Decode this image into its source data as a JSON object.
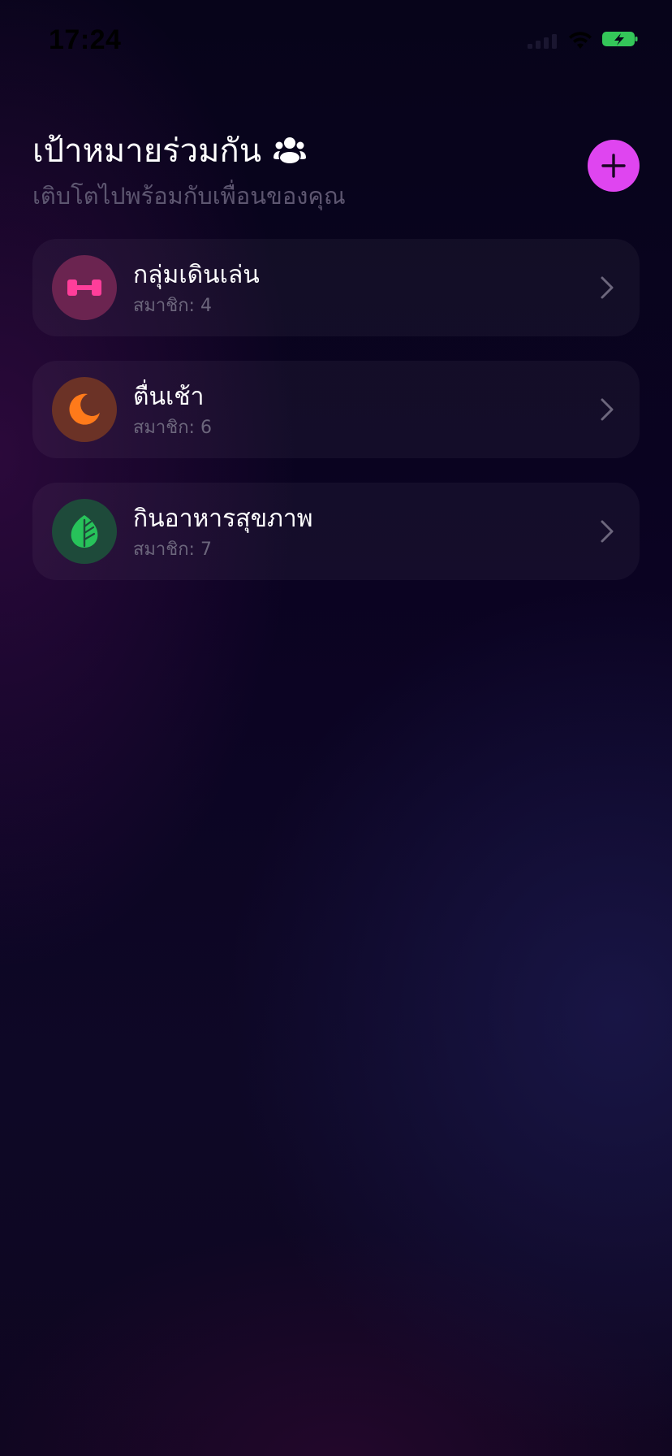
{
  "status_bar": {
    "time": "17:24",
    "battery_color": "#34c759"
  },
  "header": {
    "title": "เป้าหมายร่วมกัน",
    "title_icon": "group-people-icon",
    "subtitle": "เติบโตไปพร้อมกับเพื่อนของคุณ",
    "add_button_icon": "plus-icon",
    "add_button_color": "#df45f0"
  },
  "goals": [
    {
      "name": "กลุ่มเดินเล่น",
      "members": "สมาชิก: 4",
      "icon": "dumbbell-icon",
      "icon_color": "#ff3e9a",
      "avatar_color": "#6b2450"
    },
    {
      "name": "ตื่นเช้า",
      "members": "สมาชิก: 6",
      "icon": "moon-icon",
      "icon_color": "#ff7a1a",
      "avatar_color": "#6b3226"
    },
    {
      "name": "กินอาหารสุขภาพ",
      "members": "สมาชิก: 7",
      "icon": "leaf-icon",
      "icon_color": "#27c25a",
      "avatar_color": "#1e4a3a"
    }
  ]
}
